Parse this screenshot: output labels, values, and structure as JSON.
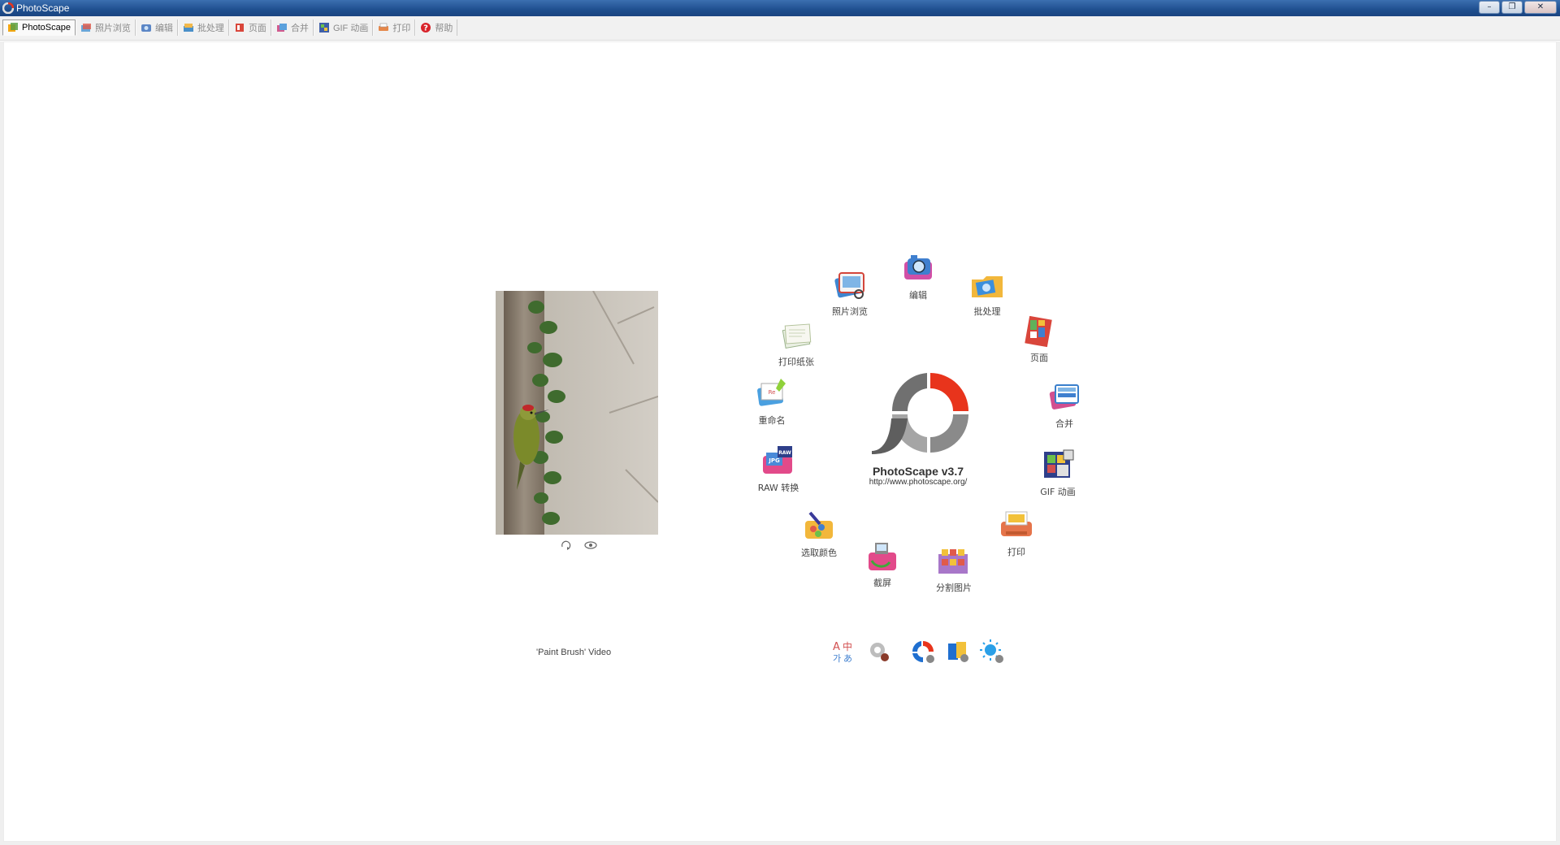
{
  "window": {
    "title": "PhotoScape",
    "minimize": "–",
    "restore": "❐",
    "close": "✕"
  },
  "tabs": [
    {
      "label": "PhotoScape",
      "icon": "photoscape-icon",
      "active": true
    },
    {
      "label": "照片浏览",
      "icon": "viewer-icon",
      "active": false
    },
    {
      "label": "编辑",
      "icon": "editor-icon",
      "active": false
    },
    {
      "label": "批处理",
      "icon": "batch-icon",
      "active": false
    },
    {
      "label": "页面",
      "icon": "page-icon",
      "active": false
    },
    {
      "label": "合并",
      "icon": "combine-icon",
      "active": false
    },
    {
      "label": "GIF 动画",
      "icon": "gif-icon",
      "active": false
    },
    {
      "label": "打印",
      "icon": "print-icon",
      "active": false
    },
    {
      "label": "帮助",
      "icon": "help-icon",
      "active": false
    }
  ],
  "preview": {
    "video_label": "'Paint Brush' Video"
  },
  "logo": {
    "title": "PhotoScape v3.7",
    "url": "http://www.photoscape.org/"
  },
  "wheel": {
    "viewer": "照片浏览",
    "editor": "编辑",
    "batch": "批处理",
    "page": "页面",
    "combine": "合并",
    "gif": "GIF 动画",
    "print": "打印",
    "splitter": "分割图片",
    "screen_capture": "截屏",
    "color_picker": "选取颜色",
    "raw_converter": "RAW 转换",
    "rename": "重命名",
    "paper_print": "打印纸张"
  },
  "colors": {
    "titlebar": "#1f4f8f",
    "logo_red": "#e8341c",
    "logo_gray": "#777777"
  }
}
